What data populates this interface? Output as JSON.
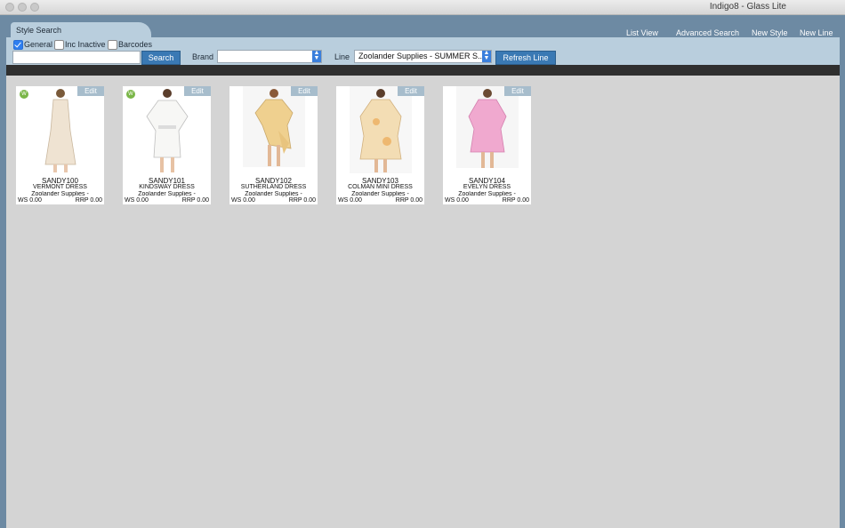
{
  "window": {
    "title": "Indigo8 - Glass Lite"
  },
  "tab": {
    "label": "Style Search"
  },
  "top_links": {
    "list_view": "List View",
    "advanced_search": "Advanced Search",
    "new_style": "New Style",
    "new_line": "New Line"
  },
  "filters": {
    "general": {
      "label": "General",
      "checked": true
    },
    "inc_inactive": {
      "label": "Inc Inactive",
      "checked": false
    },
    "barcodes": {
      "label": "Barcodes",
      "checked": false
    }
  },
  "search": {
    "value": "",
    "button": "Search"
  },
  "brand": {
    "label": "Brand",
    "value": ""
  },
  "line": {
    "label": "Line",
    "value": "Zoolander Supplies - SUMMER S...",
    "refresh_button": "Refresh Line"
  },
  "colors": {
    "accent": "#3a79b4",
    "panel": "#b9cedd",
    "window": "#6d8aa3",
    "grid": "#d4d4d4",
    "badge": "#7ab648"
  },
  "styles": [
    {
      "code": "SANDY100",
      "name": "VERMONT DRESS",
      "supplier": "Zoolander Supplies -",
      "ws": "WS 0.00",
      "rrp": "RRP 0.00",
      "edit": "Edit",
      "badge": "W",
      "dress_color": "#efe3d2"
    },
    {
      "code": "SANDY101",
      "name": "KINDSWAY DRESS",
      "supplier": "Zoolander Supplies -",
      "ws": "WS 0.00",
      "rrp": "RRP 0.00",
      "edit": "Edit",
      "badge": "W",
      "dress_color": "#f7f7f5"
    },
    {
      "code": "SANDY102",
      "name": "SUTHERLAND DRESS",
      "supplier": "Zoolander Supplies -",
      "ws": "WS 0.00",
      "rrp": "RRP 0.00",
      "edit": "Edit",
      "badge": "",
      "dress_color": "#efd08f"
    },
    {
      "code": "SANDY103",
      "name": "COLMAN MINI DRESS",
      "supplier": "Zoolander Supplies -",
      "ws": "WS 0.00",
      "rrp": "RRP 0.00",
      "edit": "Edit",
      "badge": "",
      "dress_color": "#f3ddb4"
    },
    {
      "code": "SANDY104",
      "name": "EVELYN DRESS",
      "supplier": "Zoolander Supplies -",
      "ws": "WS 0.00",
      "rrp": "RRP 0.00",
      "edit": "Edit",
      "badge": "",
      "dress_color": "#f0a9cf"
    }
  ]
}
